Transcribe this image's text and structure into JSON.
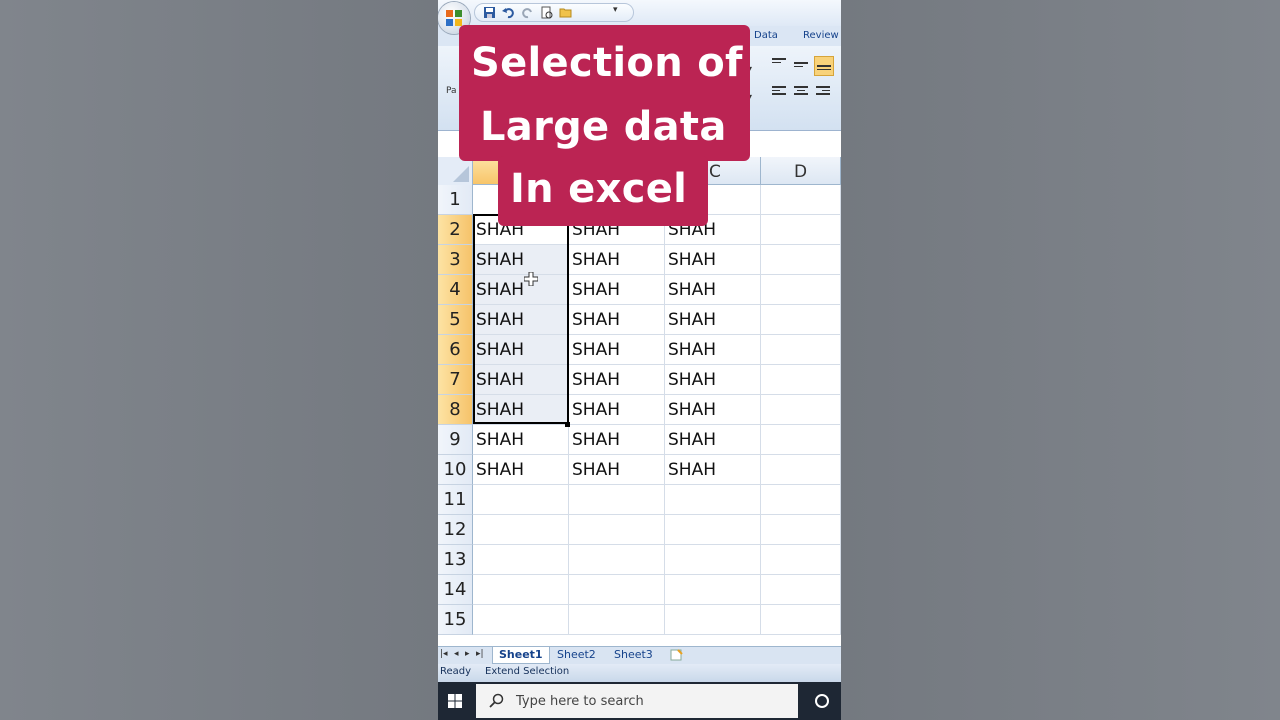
{
  "overlay": {
    "line1": "Selection of",
    "line2": "Large data",
    "line3": "In excel"
  },
  "ribbon": {
    "tabs": [
      "Data",
      "Review"
    ],
    "paste_label": "Pa"
  },
  "grid": {
    "columns": [
      "C",
      "D"
    ],
    "rows": [
      "1",
      "2",
      "3",
      "4",
      "5",
      "6",
      "7",
      "8",
      "9",
      "10",
      "11",
      "12",
      "13",
      "14",
      "15"
    ],
    "cell_text": "SHAH"
  },
  "sheet_tabs": [
    "Sheet1",
    "Sheet2",
    "Sheet3"
  ],
  "status": {
    "ready": "Ready",
    "mode": "Extend Selection"
  },
  "taskbar": {
    "search_placeholder": "Type here to search"
  },
  "colors": {
    "overlay_bg": "#bb2453",
    "selected_header": "#f8c56a",
    "ribbon_bg": "#d3e1f1"
  }
}
